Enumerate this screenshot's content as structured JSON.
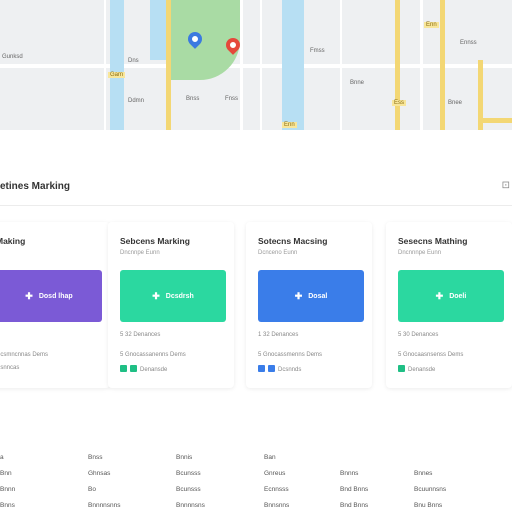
{
  "map": {
    "labels": [
      "Gunksd",
      "Dns",
      "Ddmn",
      "Bnss",
      "Fnss",
      "Fmss",
      "Bnne",
      "Ennss",
      "Bnee"
    ],
    "road_labels": [
      "Gam",
      "Enn",
      "Enn",
      "Ess"
    ],
    "pin_colors": [
      "#3b7ae0",
      "#e5483b"
    ]
  },
  "section": {
    "title": "etines Marking",
    "icon": "collapse-icon"
  },
  "cards": [
    {
      "title": "Making",
      "subtitle": "",
      "banner_label": "Dosd lhap",
      "banner_color": "#7b5ad6",
      "stat": "",
      "line": "Dcsmncnnas Dems",
      "tags": "Dsnncas",
      "tag_colors": []
    },
    {
      "title": "Sebcens Marking",
      "subtitle": "Dncnnpe Eunn",
      "banner_label": "Dcsdrsh",
      "banner_color": "#2bd8a0",
      "stat": "5 32 Denances",
      "line": "5 Gnocassanenns Dems",
      "tags": "Denansde",
      "tag_colors": [
        "#1fbf85",
        "#1fbf85"
      ]
    },
    {
      "title": "Sotecns Macsing",
      "subtitle": "Dcnceno Eunn",
      "banner_label": "Dosal",
      "banner_color": "#3a7de9",
      "stat": "1 32 Denances",
      "line": "5 Gnocassmenns Dems",
      "tags": "Dcsnnds",
      "tag_colors": [
        "#3a7de9",
        "#3a7de9"
      ]
    },
    {
      "title": "Sesecns Mathing",
      "subtitle": "Dncnnnpe Eunn",
      "banner_label": "Doeli",
      "banner_color": "#2bd8a0",
      "stat": "5 30 Denances",
      "line": "5 Gnocaasnsenss Dems",
      "tags": "Denansde",
      "tag_colors": [
        "#1fbf85"
      ]
    }
  ],
  "table": {
    "rows": [
      [
        "a",
        "Bnss",
        "Bnnis",
        "Ban",
        "",
        ""
      ],
      [
        "Bnn",
        "Ghnsas",
        "Bcunsss",
        "Gnreus",
        "Bnnns",
        "Bnnes"
      ],
      [
        "Bnnn",
        "Bo",
        "Bcunsss",
        "Ecnnsss",
        "Bnd Bnns",
        "Bcuunnsns"
      ],
      [
        "Bnns",
        "Bnnnnsnns",
        "Bnnnnsns",
        "Bnnsnns",
        "Bnd Bnns",
        "Bnu Bnns"
      ]
    ]
  }
}
